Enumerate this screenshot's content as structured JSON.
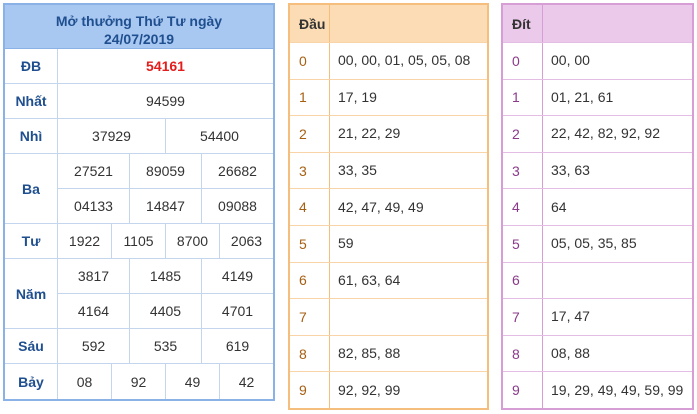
{
  "results": {
    "title_line1": "Mở thưởng Thứ Tư ngày",
    "title_line2": "24/07/2019",
    "rows": [
      {
        "label": "ĐB",
        "lines": [
          [
            "54161"
          ]
        ]
      },
      {
        "label": "Nhất",
        "lines": [
          [
            "94599"
          ]
        ]
      },
      {
        "label": "Nhì",
        "lines": [
          [
            "37929",
            "54400"
          ]
        ]
      },
      {
        "label": "Ba",
        "lines": [
          [
            "27521",
            "89059",
            "26682"
          ],
          [
            "04133",
            "14847",
            "09088"
          ]
        ]
      },
      {
        "label": "Tư",
        "lines": [
          [
            "1922",
            "1105",
            "8700",
            "2063"
          ]
        ]
      },
      {
        "label": "Năm",
        "lines": [
          [
            "3817",
            "1485",
            "4149"
          ],
          [
            "4164",
            "4405",
            "4701"
          ]
        ]
      },
      {
        "label": "Sáu",
        "lines": [
          [
            "592",
            "535",
            "619"
          ]
        ]
      },
      {
        "label": "Bảy",
        "lines": [
          [
            "08",
            "92",
            "49",
            "42"
          ]
        ]
      }
    ]
  },
  "dau": {
    "header": "Đầu",
    "rows": [
      {
        "key": "0",
        "value": "00, 00, 01, 05, 05, 08"
      },
      {
        "key": "1",
        "value": "17, 19"
      },
      {
        "key": "2",
        "value": "21, 22, 29"
      },
      {
        "key": "3",
        "value": "33, 35"
      },
      {
        "key": "4",
        "value": "42, 47, 49, 49"
      },
      {
        "key": "5",
        "value": "59"
      },
      {
        "key": "6",
        "value": "61, 63, 64"
      },
      {
        "key": "7",
        "value": ""
      },
      {
        "key": "8",
        "value": "82, 85, 88"
      },
      {
        "key": "9",
        "value": "92, 92, 99"
      }
    ]
  },
  "dit": {
    "header": "Đít",
    "rows": [
      {
        "key": "0",
        "value": "00, 00"
      },
      {
        "key": "1",
        "value": "01, 21, 61"
      },
      {
        "key": "2",
        "value": "22, 42, 82, 92, 92"
      },
      {
        "key": "3",
        "value": "33, 63"
      },
      {
        "key": "4",
        "value": "64"
      },
      {
        "key": "5",
        "value": "05, 05, 35, 85"
      },
      {
        "key": "6",
        "value": ""
      },
      {
        "key": "7",
        "value": "17, 47"
      },
      {
        "key": "8",
        "value": "08, 88"
      },
      {
        "key": "9",
        "value": "19, 29, 49, 49, 59, 99"
      }
    ]
  },
  "colors": {
    "results_header_bg": "#a9c8f1",
    "results_border": "#8ab2e6",
    "special_prize_text": "#e31c1c",
    "dau_header_bg": "#fbdcb4",
    "dau_border": "#f5be7c",
    "dit_header_bg": "#eac9ea",
    "dit_border": "#d79ed6"
  }
}
